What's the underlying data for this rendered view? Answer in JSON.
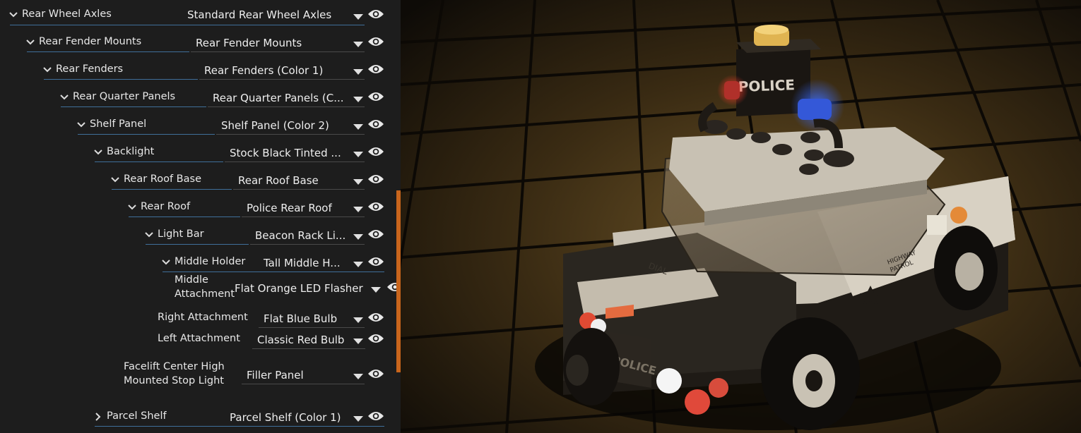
{
  "tree": [
    {
      "label": "Rear Wheel Axles",
      "value": "Standard Rear Wheel Axles",
      "expanded": true
    },
    {
      "label": "Rear Fender Mounts",
      "value": "Rear Fender Mounts",
      "expanded": true
    },
    {
      "label": "Rear Fenders",
      "value": "Rear Fenders (Color 1)",
      "expanded": true
    },
    {
      "label": "Rear Quarter Panels",
      "value": "Rear Quarter Panels (C...",
      "expanded": true
    },
    {
      "label": "Shelf Panel",
      "value": "Shelf Panel (Color 2)",
      "expanded": true
    },
    {
      "label": "Backlight",
      "value": "Stock Black Tinted ...",
      "expanded": true
    },
    {
      "label": "Rear Roof Base",
      "value": "Rear Roof Base",
      "expanded": true
    },
    {
      "label": "Rear Roof",
      "value": "Police Rear Roof",
      "expanded": true
    },
    {
      "label": "Light Bar",
      "value": "Beacon Rack Li...",
      "expanded": true
    },
    {
      "label": "Middle Holder",
      "value": "Tall Middle H...",
      "expanded": true
    },
    {
      "label_line1": "Middle",
      "label_line2": "Attachment",
      "value": "Flat Orange LED Flasher"
    },
    {
      "label": "Right Attachment",
      "value": "Flat Blue Bulb"
    },
    {
      "label": "Left Attachment",
      "value": "Classic Red Bulb"
    },
    {
      "label_line1": "Facelift Center High",
      "label_line2": "Mounted Stop Light",
      "value": "Filler Panel"
    },
    {
      "label": "Parcel Shelf",
      "value": "Parcel Shelf (Color 1)",
      "expanded": false
    }
  ],
  "viewport": {
    "roof_sign_text": "POLICE",
    "plate_text": "POLICE",
    "trunk_text": "DIAL",
    "side_text_1": "HIGHWAY",
    "side_text_2": "PATROL"
  },
  "colors": {
    "accent": "#c8651c",
    "underline": "#3f6f9a",
    "panel_bg": "#1d1d1d"
  },
  "icons": {
    "expand": "chevron-down-icon",
    "collapsed": "chevron-right-icon",
    "dropdown": "dropdown-triangle-icon",
    "visibility": "eye-icon"
  }
}
